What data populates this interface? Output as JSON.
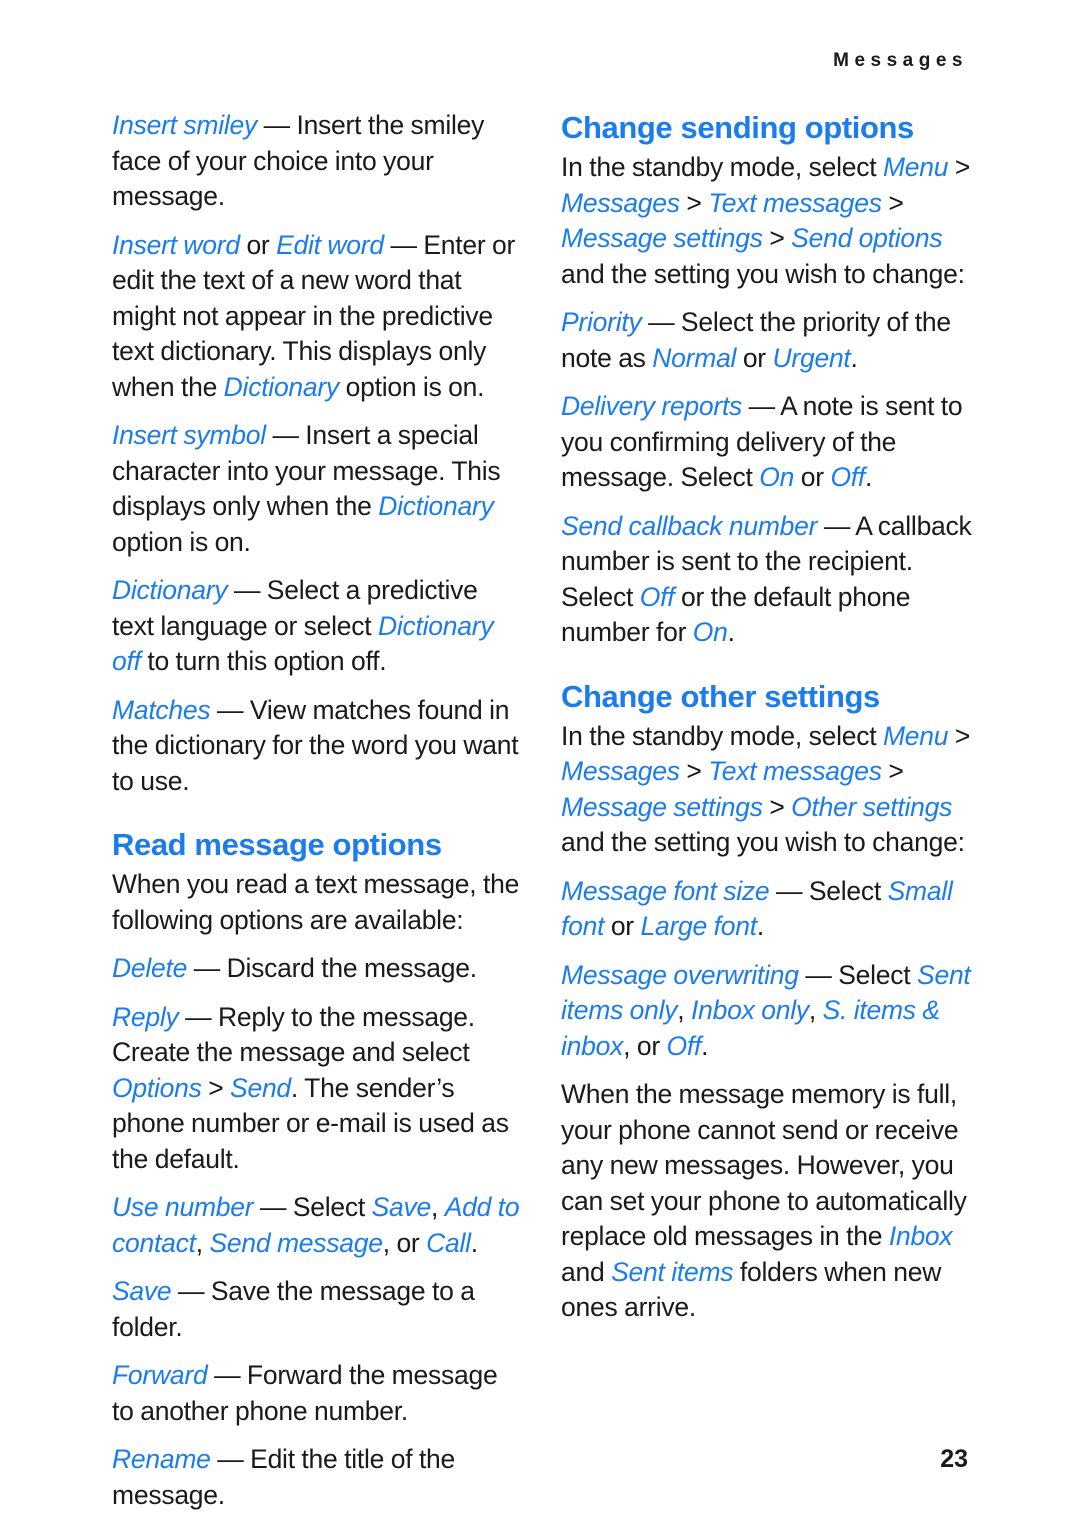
{
  "header": {
    "running_head": "Messages"
  },
  "footer": {
    "page_number": "23"
  },
  "colors": {
    "accent_blue": "#1b7ced",
    "body_text": "#1a1a1a",
    "page_background": "#ffffff"
  },
  "left_column": {
    "blocks": [
      {
        "type": "paragraph",
        "name": "para-insert-smiley",
        "runs": [
          {
            "style": "ui",
            "text": "Insert smiley"
          },
          {
            "style": "plain",
            "text": " — Insert the smiley face of your choice into your message."
          }
        ]
      },
      {
        "type": "paragraph",
        "name": "para-insert-word",
        "runs": [
          {
            "style": "ui",
            "text": "Insert word"
          },
          {
            "style": "plain",
            "text": " or "
          },
          {
            "style": "ui",
            "text": "Edit word"
          },
          {
            "style": "plain",
            "text": " — Enter or edit the text of a new word that might not appear in the predictive text dictionary. This displays only when the "
          },
          {
            "style": "ui",
            "text": "Dictionary"
          },
          {
            "style": "plain",
            "text": " option is on."
          }
        ]
      },
      {
        "type": "paragraph",
        "name": "para-insert-symbol",
        "runs": [
          {
            "style": "ui",
            "text": "Insert symbol"
          },
          {
            "style": "plain",
            "text": " — Insert a special character into your message. This displays only when the "
          },
          {
            "style": "ui",
            "text": "Dictionary"
          },
          {
            "style": "plain",
            "text": " option is on."
          }
        ]
      },
      {
        "type": "paragraph",
        "name": "para-dictionary",
        "runs": [
          {
            "style": "ui",
            "text": "Dictionary"
          },
          {
            "style": "plain",
            "text": " — Select a predictive text language or select "
          },
          {
            "style": "ui",
            "text": "Dictionary off"
          },
          {
            "style": "plain",
            "text": " to turn this option off."
          }
        ]
      },
      {
        "type": "paragraph",
        "name": "para-matches",
        "runs": [
          {
            "style": "ui",
            "text": "Matches"
          },
          {
            "style": "plain",
            "text": " — View matches found in the dictionary for the word you want to use."
          }
        ]
      },
      {
        "type": "heading",
        "name": "heading-read-message-options",
        "text": "Read message options"
      },
      {
        "type": "paragraph",
        "name": "para-read-intro",
        "runs": [
          {
            "style": "plain",
            "text": "When you read a text message, the following options are available:"
          }
        ]
      },
      {
        "type": "paragraph",
        "name": "para-delete",
        "runs": [
          {
            "style": "ui",
            "text": "Delete"
          },
          {
            "style": "plain",
            "text": " — Discard the message."
          }
        ]
      },
      {
        "type": "paragraph",
        "name": "para-reply",
        "runs": [
          {
            "style": "ui",
            "text": "Reply"
          },
          {
            "style": "plain",
            "text": " — Reply to the message. Create the message and select "
          },
          {
            "style": "ui",
            "text": "Options"
          },
          {
            "style": "plain",
            "text": " > "
          },
          {
            "style": "ui",
            "text": "Send"
          },
          {
            "style": "plain",
            "text": ". The sender’s phone number or e-mail is used as the default."
          }
        ]
      },
      {
        "type": "paragraph",
        "name": "para-use-number",
        "runs": [
          {
            "style": "ui",
            "text": "Use number"
          },
          {
            "style": "plain",
            "text": " — Select "
          },
          {
            "style": "ui",
            "text": "Save"
          },
          {
            "style": "plain",
            "text": ", "
          },
          {
            "style": "ui",
            "text": "Add to contact"
          },
          {
            "style": "plain",
            "text": ", "
          },
          {
            "style": "ui",
            "text": "Send message"
          },
          {
            "style": "plain",
            "text": ", or "
          },
          {
            "style": "ui",
            "text": "Call"
          },
          {
            "style": "plain",
            "text": "."
          }
        ]
      },
      {
        "type": "paragraph",
        "name": "para-save",
        "runs": [
          {
            "style": "ui",
            "text": "Save"
          },
          {
            "style": "plain",
            "text": " — Save the message to a folder."
          }
        ]
      },
      {
        "type": "paragraph",
        "name": "para-forward",
        "runs": [
          {
            "style": "ui",
            "text": "Forward"
          },
          {
            "style": "plain",
            "text": " — Forward the message to another phone number."
          }
        ]
      },
      {
        "type": "paragraph",
        "name": "para-rename",
        "runs": [
          {
            "style": "ui",
            "text": "Rename"
          },
          {
            "style": "plain",
            "text": " — Edit the title of the message."
          }
        ]
      }
    ]
  },
  "right_column": {
    "blocks": [
      {
        "type": "heading",
        "name": "heading-change-sending-options",
        "text": "Change sending options"
      },
      {
        "type": "paragraph",
        "name": "para-sending-path",
        "runs": [
          {
            "style": "plain",
            "text": "In the standby mode, select "
          },
          {
            "style": "ui",
            "text": "Menu"
          },
          {
            "style": "plain",
            "text": " > "
          },
          {
            "style": "ui",
            "text": "Messages"
          },
          {
            "style": "plain",
            "text": " > "
          },
          {
            "style": "ui",
            "text": "Text messages"
          },
          {
            "style": "plain",
            "text": " > "
          },
          {
            "style": "ui",
            "text": "Message settings"
          },
          {
            "style": "plain",
            "text": " > "
          },
          {
            "style": "ui",
            "text": "Send options"
          },
          {
            "style": "plain",
            "text": " and the setting you wish to change:"
          }
        ]
      },
      {
        "type": "paragraph",
        "name": "para-priority",
        "runs": [
          {
            "style": "ui",
            "text": "Priority"
          },
          {
            "style": "plain",
            "text": " — Select the priority of the note as "
          },
          {
            "style": "ui",
            "text": "Normal"
          },
          {
            "style": "plain",
            "text": " or "
          },
          {
            "style": "ui",
            "text": "Urgent"
          },
          {
            "style": "plain",
            "text": "."
          }
        ]
      },
      {
        "type": "paragraph",
        "name": "para-delivery-reports",
        "runs": [
          {
            "style": "ui",
            "text": "Delivery reports"
          },
          {
            "style": "plain",
            "text": " — A note is sent to you confirming delivery of the message. Select "
          },
          {
            "style": "ui",
            "text": "On"
          },
          {
            "style": "plain",
            "text": " or "
          },
          {
            "style": "ui",
            "text": "Off"
          },
          {
            "style": "plain",
            "text": "."
          }
        ]
      },
      {
        "type": "paragraph",
        "name": "para-send-callback-number",
        "runs": [
          {
            "style": "ui",
            "text": "Send callback number"
          },
          {
            "style": "plain",
            "text": " — A callback number is sent to the recipient. Select "
          },
          {
            "style": "ui",
            "text": "Off"
          },
          {
            "style": "plain",
            "text": " or the default phone number for "
          },
          {
            "style": "ui",
            "text": "On"
          },
          {
            "style": "plain",
            "text": "."
          }
        ]
      },
      {
        "type": "heading",
        "name": "heading-change-other-settings",
        "text": "Change other settings"
      },
      {
        "type": "paragraph",
        "name": "para-other-path",
        "runs": [
          {
            "style": "plain",
            "text": "In the standby mode, select "
          },
          {
            "style": "ui",
            "text": "Menu"
          },
          {
            "style": "plain",
            "text": " > "
          },
          {
            "style": "ui",
            "text": "Messages"
          },
          {
            "style": "plain",
            "text": " > "
          },
          {
            "style": "ui",
            "text": "Text messages"
          },
          {
            "style": "plain",
            "text": " > "
          },
          {
            "style": "ui",
            "text": "Message settings"
          },
          {
            "style": "plain",
            "text": " > "
          },
          {
            "style": "ui",
            "text": "Other settings"
          },
          {
            "style": "plain",
            "text": " and the setting you wish to change:"
          }
        ]
      },
      {
        "type": "paragraph",
        "name": "para-message-font-size",
        "runs": [
          {
            "style": "ui",
            "text": "Message font size"
          },
          {
            "style": "plain",
            "text": " — Select "
          },
          {
            "style": "ui",
            "text": "Small font"
          },
          {
            "style": "plain",
            "text": " or "
          },
          {
            "style": "ui",
            "text": "Large font"
          },
          {
            "style": "plain",
            "text": "."
          }
        ]
      },
      {
        "type": "paragraph",
        "name": "para-message-overwriting",
        "runs": [
          {
            "style": "ui",
            "text": "Message overwriting"
          },
          {
            "style": "plain",
            "text": " — Select "
          },
          {
            "style": "ui",
            "text": "Sent items only"
          },
          {
            "style": "plain",
            "text": ", "
          },
          {
            "style": "ui",
            "text": "Inbox only"
          },
          {
            "style": "plain",
            "text": ", "
          },
          {
            "style": "ui",
            "text": "S. items & inbox"
          },
          {
            "style": "plain",
            "text": ", or "
          },
          {
            "style": "ui",
            "text": "Off"
          },
          {
            "style": "plain",
            "text": "."
          }
        ]
      },
      {
        "type": "paragraph",
        "name": "para-memory-full",
        "runs": [
          {
            "style": "plain",
            "text": "When the message memory is full, your phone cannot send or receive any new messages. However, you can set your phone to automatically replace old messages in the "
          },
          {
            "style": "ui",
            "text": "Inbox"
          },
          {
            "style": "plain",
            "text": " and "
          },
          {
            "style": "ui",
            "text": "Sent items"
          },
          {
            "style": "plain",
            "text": " folders when new ones arrive."
          }
        ]
      }
    ]
  }
}
